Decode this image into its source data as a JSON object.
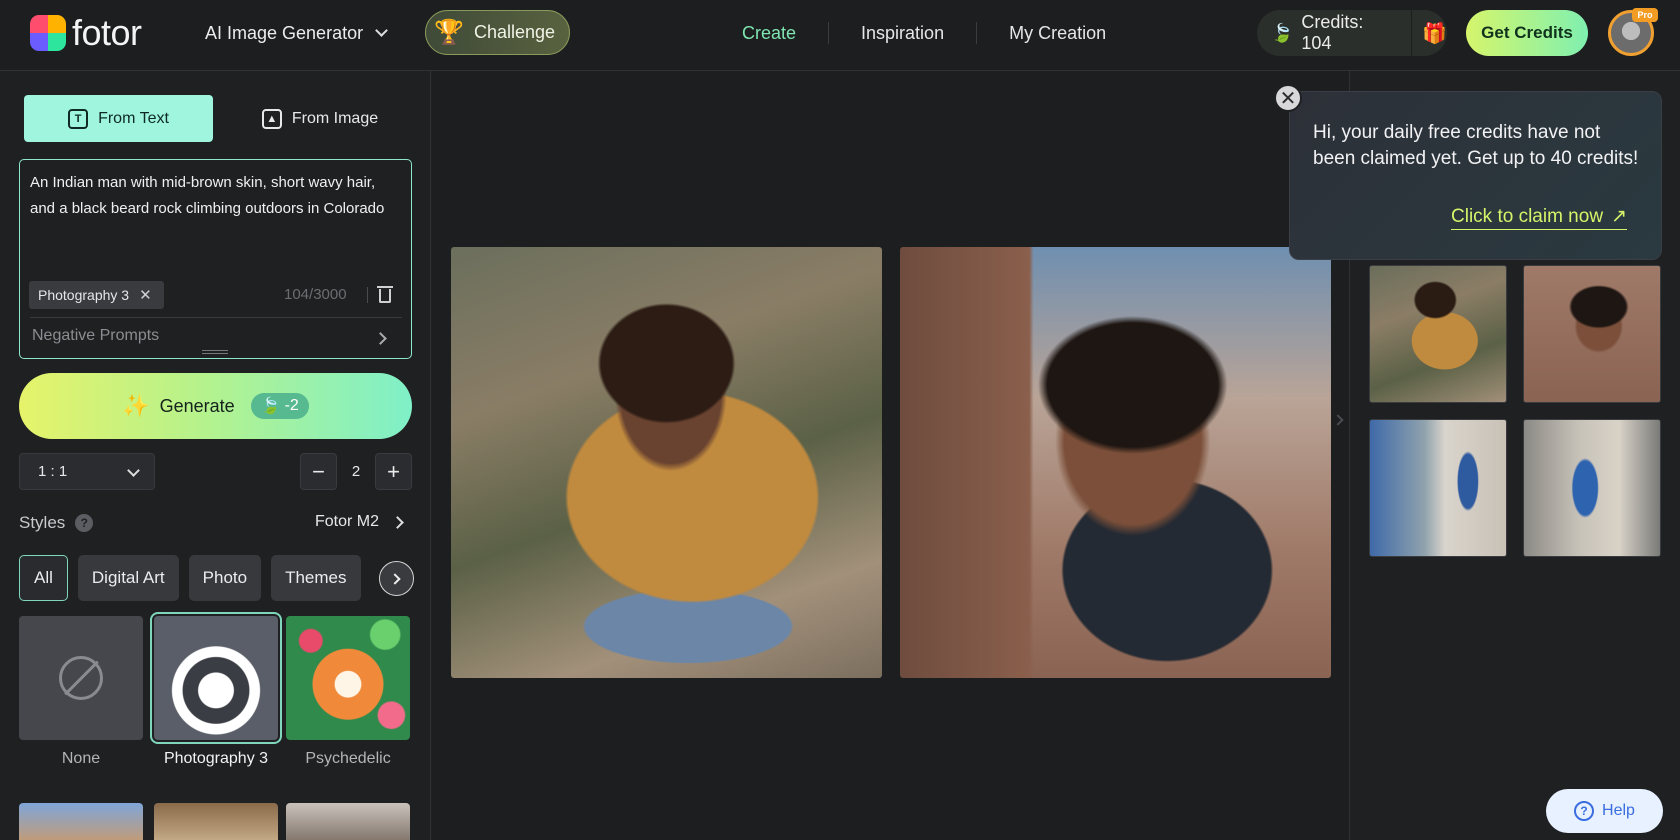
{
  "header": {
    "logo_text": "fotor",
    "tool_menu_label": "AI Image Generator",
    "challenge_label": "Challenge",
    "nav": [
      {
        "label": "Create",
        "active": true
      },
      {
        "label": "Inspiration",
        "active": false
      },
      {
        "label": "My Creation",
        "active": false
      }
    ],
    "credits_label": "Credits: 104",
    "get_credits_label": "Get Credits",
    "avatar_badge": "Pro"
  },
  "panel": {
    "tabs": [
      {
        "label": "From Text",
        "icon": "text-t-icon",
        "active": true
      },
      {
        "label": "From Image",
        "icon": "image-icon",
        "active": false
      }
    ],
    "prompt": {
      "value": "An Indian man with mid-brown skin, short wavy hair, and a black beard rock climbing outdoors in Colorado",
      "style_chip": "Photography 3",
      "char_count": "104/3000",
      "negative_label": "Negative Prompts"
    },
    "generate": {
      "label": "Generate",
      "cost": "-2"
    },
    "ratio": "1 : 1",
    "quantity": "2",
    "styles_label": "Styles",
    "model_label": "Fotor M2",
    "style_tabs": [
      {
        "label": "All",
        "active": true
      },
      {
        "label": "Digital Art",
        "active": false
      },
      {
        "label": "Photo",
        "active": false
      },
      {
        "label": "Themes",
        "active": false
      }
    ],
    "style_cards": [
      {
        "name": "None",
        "selected": false
      },
      {
        "name": "Photography 3",
        "selected": true
      },
      {
        "name": "Psychedelic",
        "selected": false
      }
    ]
  },
  "popup": {
    "message": "Hi, your daily free credits have not been claimed yet. Get up to 40 credits!",
    "cta": "Click to claim now"
  },
  "help_label": "Help",
  "colors": {
    "accent": "#7fe6b1",
    "tab_active": "#9ff5de",
    "claim_link": "#d6f36a"
  }
}
